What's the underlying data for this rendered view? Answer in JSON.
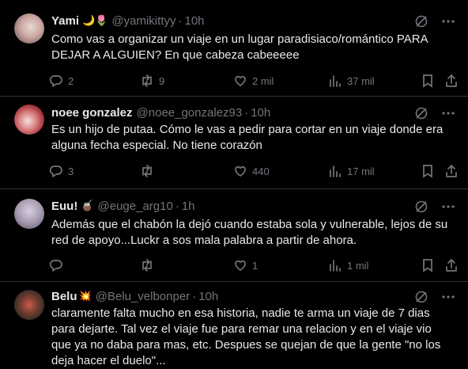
{
  "tweets": [
    {
      "name": "Yami",
      "emoji": "🌙🌷",
      "handle": "@yamikittyy",
      "time": "10h",
      "text": "Como vas a organizar un viaje en un lugar paradisiaco/romántico PARA DEJAR A ALGUIEN? En que cabeza cabeeeee",
      "replies": "2",
      "retweets": "9",
      "likes": "2 mil",
      "views": "37 mil",
      "avatar_color": "#c9a7a0"
    },
    {
      "name": "noee gonzalez",
      "emoji": "",
      "handle": "@noee_gonzalez93",
      "time": "10h",
      "text": "Es un hijo de putaa. Cómo le vas a pedir para cortar en un viaje donde era alguna fecha especial. No tiene corazón",
      "replies": "3",
      "retweets": "",
      "likes": "440",
      "views": "17 mil",
      "avatar_color": "#b84a4f"
    },
    {
      "name": "Euu!",
      "emoji": "🧉",
      "handle": "@euge_arg10",
      "time": "1h",
      "text": "Además que el chabón la dejó cuando estaba sola y vulnerable, lejos de su red de apoyo...Luckr a sos mala palabra a partir de ahora.",
      "replies": "",
      "retweets": "",
      "likes": "1",
      "views": "1 mil",
      "avatar_color": "#a79bb0"
    },
    {
      "name": "Belu",
      "emoji": "💥",
      "handle": "@Belu_velbonper",
      "time": "10h",
      "text": "claramente falta mucho en esa historia, nadie te arma un viaje de 7 dias para dejarte. Tal vez el viaje fue para remar una relacion y en el viaje vio que ya no daba para mas, etc. Despues se quejan de que la gente \"no los deja hacer el duelo\"...",
      "replies": "",
      "retweets": "",
      "likes": "",
      "views": "",
      "avatar_color": "#6b3a2e"
    }
  ]
}
